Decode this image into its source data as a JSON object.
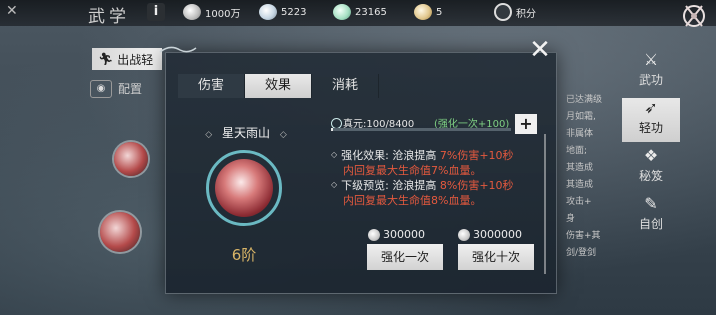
{
  "topbar": {
    "title": "武学",
    "info": "i",
    "resources": [
      {
        "name": "currency-1",
        "value": "1000万"
      },
      {
        "name": "currency-2",
        "value": "5223"
      },
      {
        "name": "currency-3",
        "value": "23165"
      },
      {
        "name": "currency-4",
        "value": "5"
      }
    ],
    "points_label": "积分"
  },
  "left": {
    "out_button": "出战轻",
    "config_label": "配置"
  },
  "right_tabs": [
    {
      "label": "武功",
      "icon": "martial-icon"
    },
    {
      "label": "轻功",
      "icon": "lightness-icon"
    },
    {
      "label": "秘笈",
      "icon": "scroll-icon"
    },
    {
      "label": "自创",
      "icon": "create-icon"
    }
  ],
  "modal": {
    "tabs": [
      "伤害",
      "效果",
      "消耗"
    ],
    "active_tab": 1,
    "skill": {
      "name": "星天雨山",
      "level": "6阶"
    },
    "zhenyuan": {
      "label": "真元:",
      "value": "100/8400",
      "progress": 0.012,
      "bonus": "(强化一次+100)"
    },
    "effects": [
      {
        "label": "强化效果:",
        "prefix": "沧浪提高",
        "value": "7%伤害+10秒",
        "line2": "内回复最大生命值7%血量。"
      },
      {
        "label": "下级预览:",
        "prefix": "沧浪提高",
        "value": "8%伤害+10秒",
        "line2": "内回复最大生命值8%血量。"
      }
    ],
    "costs": [
      {
        "amount": "300000",
        "button": "强化一次"
      },
      {
        "amount": "3000000",
        "button": "强化十次"
      }
    ]
  },
  "right_peek": [
    "已达满级",
    "月如霜,",
    "",
    "非属体",
    "地面;",
    "其造成",
    "其造成",
    "攻击+",
    "身",
    "伤害+其",
    "",
    "剑/登剑"
  ],
  "colors": {
    "accent_red": "#e4593e",
    "bonus_green": "#7fd083",
    "level_gold": "#d8b467"
  }
}
